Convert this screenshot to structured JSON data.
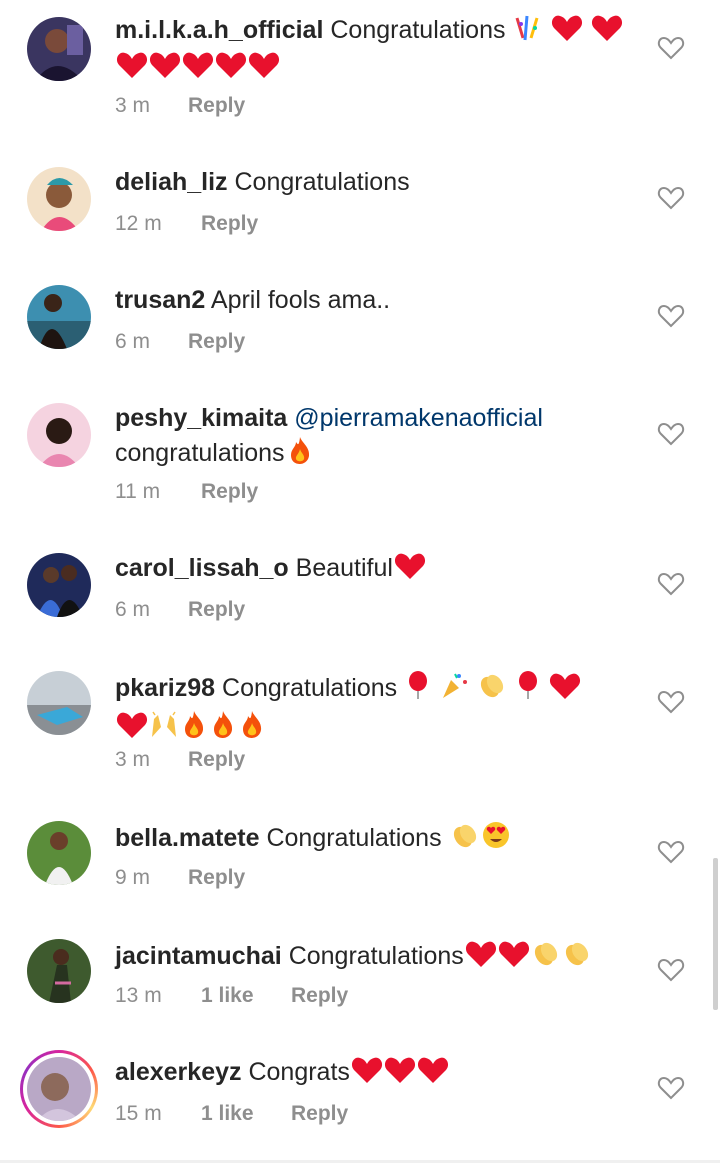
{
  "comments": [
    {
      "username": "m.i.l.k.a.h_official",
      "text": "Congratulations",
      "emojis": [
        "confetti-ball-emoji",
        "heart-emoji",
        "heart-emoji",
        "heart-emoji",
        "heart-emoji",
        "heart-emoji",
        "heart-emoji",
        "heart-emoji"
      ],
      "time": "3 m",
      "likes": "",
      "reply": "Reply"
    },
    {
      "username": "deliah_liz",
      "text": "Congratulations",
      "emojis": [],
      "time": "12 m",
      "likes": "",
      "reply": "Reply"
    },
    {
      "username": "trusan2",
      "text": "April fools ama..",
      "emojis": [],
      "time": "6 m",
      "likes": "",
      "reply": "Reply"
    },
    {
      "username": "peshy_kimaita",
      "mention": "@pierramakenaofficial",
      "text": "congratulations",
      "emojis": [
        "fire-emoji"
      ],
      "time": "11 m",
      "likes": "",
      "reply": "Reply"
    },
    {
      "username": "carol_lissah_o",
      "text": "Beautiful",
      "emojis": [
        "heart-emoji"
      ],
      "time": "6 m",
      "likes": "",
      "reply": "Reply"
    },
    {
      "username": "pkariz98",
      "text": "Congratulations",
      "emojis": [
        "balloon-emoji",
        "party-popper-emoji",
        "clapping-hands-emoji",
        "balloon-emoji",
        "heart-emoji",
        "heart-emoji",
        "raising-hands-emoji",
        "fire-emoji",
        "fire-emoji",
        "fire-emoji"
      ],
      "time": "3 m",
      "likes": "",
      "reply": "Reply"
    },
    {
      "username": "bella.matete",
      "text": "Congratulations",
      "emojis": [
        "clapping-hands-emoji",
        "heart-eyes-emoji"
      ],
      "time": "9 m",
      "likes": "",
      "reply": "Reply"
    },
    {
      "username": "jacintamuchai",
      "text": "Congratulations",
      "emojis": [
        "heart-emoji",
        "heart-emoji",
        "clapping-hands-emoji",
        "clapping-hands-emoji"
      ],
      "time": "13 m",
      "likes": "1 like",
      "reply": "Reply"
    },
    {
      "username": "alexerkeyz",
      "text": "Congrats",
      "emojis": [
        "heart-emoji",
        "heart-emoji",
        "heart-emoji"
      ],
      "time": "15 m",
      "likes": "1 like",
      "reply": "Reply"
    }
  ],
  "icons": {
    "like": "heart-outline-icon"
  },
  "colors": {
    "text": "#262626",
    "meta": "#8e8e8e",
    "mention": "#00376b",
    "heart": "#e8112d"
  }
}
